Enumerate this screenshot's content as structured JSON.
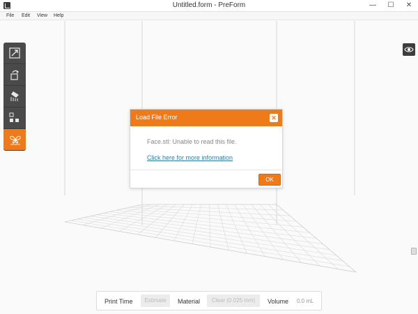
{
  "window": {
    "title": "Untitled.form - PreForm",
    "minimize": "—",
    "maximize": "☐",
    "close": "✕"
  },
  "menu": {
    "items": [
      "File",
      "Edit",
      "View",
      "Help"
    ]
  },
  "toolbar": {
    "tools": [
      {
        "name": "scale-icon"
      },
      {
        "name": "orientation-icon"
      },
      {
        "name": "supports-icon"
      },
      {
        "name": "layout-icon"
      },
      {
        "name": "one-click-print-icon",
        "active": true
      }
    ],
    "visibility_icon": "eye-icon"
  },
  "dialog": {
    "title": "Load File Error",
    "close_glyph": "✕",
    "message": "Face.stl: Unable to read this file.",
    "link": "Click here for more information",
    "ok_label": "OK"
  },
  "status": {
    "print_time_label": "Print Time",
    "estimate_label": "Estimate",
    "material_label": "Material",
    "material_value": "Clear (0.025 mm)",
    "volume_label": "Volume",
    "volume_value": "0.0 mL"
  },
  "colors": {
    "accent": "#ef7a1a",
    "toolbar": "#4a4a4a",
    "link": "#2c7f9e"
  }
}
